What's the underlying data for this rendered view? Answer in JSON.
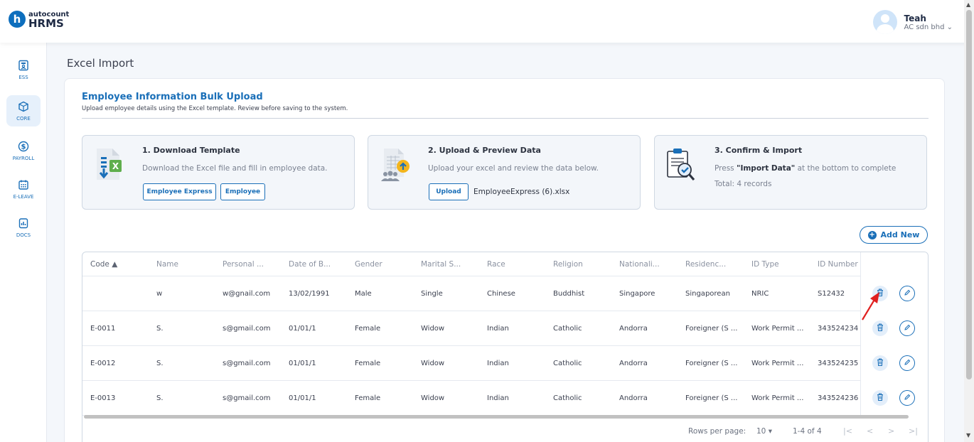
{
  "brand": {
    "small": "autocount",
    "big": "HRMS",
    "mark": "h"
  },
  "user": {
    "name": "Teah",
    "company": "AC sdn bhd ⌄"
  },
  "sidebar": {
    "items": [
      {
        "label": "ESS",
        "icon": "ess-icon",
        "active": false
      },
      {
        "label": "CORE",
        "icon": "core-icon",
        "active": true
      },
      {
        "label": "PAYROLL",
        "icon": "payroll-icon",
        "active": false
      },
      {
        "label": "E-LEAVE",
        "icon": "calendar-icon",
        "active": false
      },
      {
        "label": "DOCS",
        "icon": "docs-icon",
        "active": false
      }
    ]
  },
  "page": {
    "title": "Excel Import"
  },
  "card": {
    "title": "Employee Information Bulk Upload",
    "subtitle": "Upload employee details using the Excel template. Review before saving to the system."
  },
  "steps": {
    "download": {
      "title": "1. Download Template",
      "desc": "Download the Excel file and fill in employee data.",
      "btn_express": "Employee Express",
      "btn_employee": "Employee"
    },
    "upload": {
      "title": "2. Upload & Preview Data",
      "desc": "Upload your excel and review the data below.",
      "btn_upload": "Upload",
      "file_name": "EmployeeExpress (6).xlsx"
    },
    "confirm": {
      "title": "3. Confirm & Import",
      "desc_prefix": "Press ",
      "desc_bold": "\"Import Data\"",
      "desc_suffix": " at the bottom to complete",
      "total": "Total: 4 records"
    }
  },
  "add_new_label": "Add New",
  "table": {
    "headers": [
      "Code ▲",
      "Name",
      "Personal ...",
      "Date of B...",
      "Gender",
      "Marital S...",
      "Race",
      "Religion",
      "Nationali...",
      "Residenc...",
      "ID Type",
      "ID Number"
    ],
    "rows": [
      [
        "",
        "w",
        "w@gnail.com",
        "13/02/1991",
        "Male",
        "Single",
        "Chinese",
        "Buddhist",
        "Singapore",
        "Singaporean",
        "NRIC",
        "S12432"
      ],
      [
        "E-0011",
        "S.",
        "s@gmail.com",
        "01/01/1",
        "Female",
        "Widow",
        "Indian",
        "Catholic",
        "Andorra",
        "Foreigner (S ...",
        "Work Permit ...",
        "343524234"
      ],
      [
        "E-0012",
        "S.",
        "s@gmail.com",
        "01/01/1",
        "Female",
        "Widow",
        "Indian",
        "Catholic",
        "Andorra",
        "Foreigner (S ...",
        "Work Permit ...",
        "343524235"
      ],
      [
        "E-0013",
        "S.",
        "s@gmail.com",
        "01/01/1",
        "Female",
        "Widow",
        "Indian",
        "Catholic",
        "Andorra",
        "Foreigner (S ...",
        "Work Permit ...",
        "343524236"
      ]
    ]
  },
  "pager": {
    "rows_label": "Rows per page:",
    "rows_value": "10",
    "range": "1-4 of 4"
  },
  "colors": {
    "accent": "#1a6fb8",
    "arrow": "#e02020"
  }
}
